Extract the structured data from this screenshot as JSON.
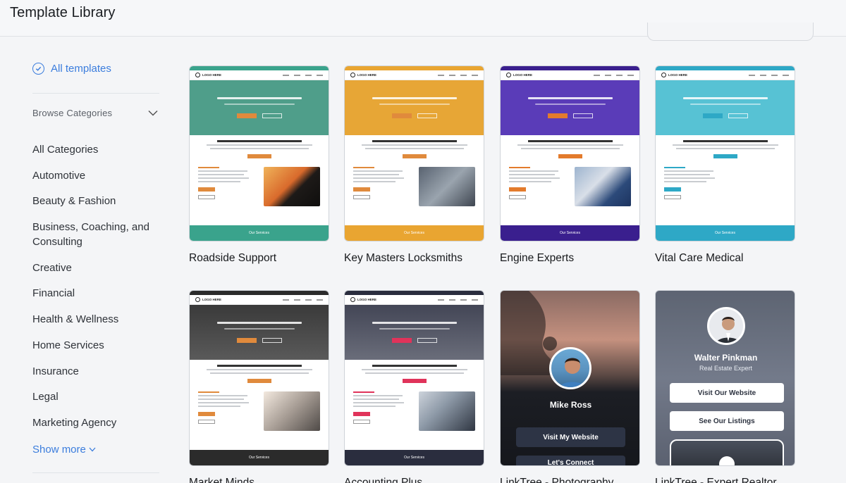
{
  "header": {
    "title": "Template Library"
  },
  "sidebar": {
    "all_templates": "All templates",
    "browse_label": "Browse Categories",
    "categories": [
      "All Categories",
      "Automotive",
      "Beauty & Fashion",
      "Business, Coaching, and Consulting",
      "Creative",
      "Financial",
      "Health & Wellness",
      "Home Services",
      "Insurance",
      "Legal",
      "Marketing Agency"
    ],
    "show_more": "Show more"
  },
  "templates": [
    {
      "name": "Roadside Support",
      "accent": "#3aa38c",
      "hero": "#4f9e8a"
    },
    {
      "name": "Key Masters Locksmiths",
      "accent": "#e9a531",
      "hero": "#e7a636"
    },
    {
      "name": "Engine Experts",
      "accent": "#3a1f8e",
      "hero": "#5a3cb8"
    },
    {
      "name": "Vital Care Medical",
      "accent": "#2ea8c6",
      "hero": "#57c2d4"
    },
    {
      "name": "Market Minds",
      "accent": "#2b2b2b",
      "hero": "#4a4a4a"
    },
    {
      "name": "Accounting Plus",
      "accent": "#2a2d3e",
      "hero": "#5b5e6c"
    },
    {
      "name": "LinkTree - Photography",
      "person": "Mike Ross",
      "button1": "Visit My Website",
      "button2": "Let's Connect"
    },
    {
      "name": "LinkTree - Expert Realtor",
      "person": "Walter Pinkman",
      "role": "Real Estate Expert",
      "button1": "Visit Our Website",
      "button2": "See Our Listings"
    }
  ]
}
